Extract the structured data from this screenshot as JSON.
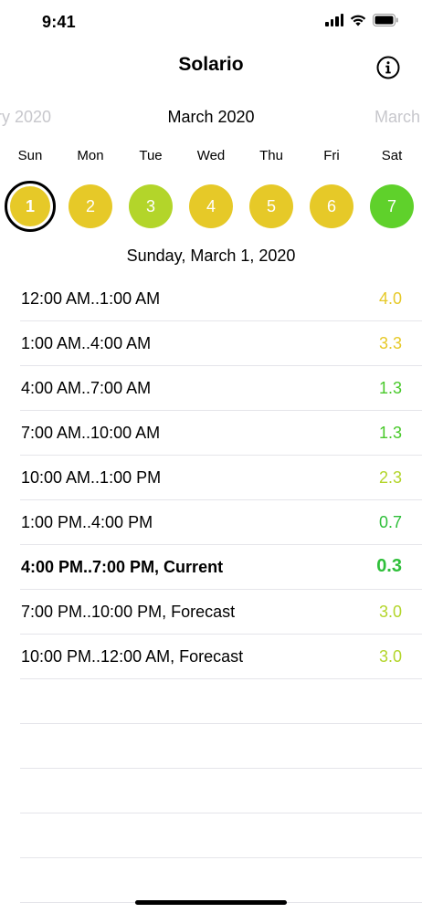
{
  "status_bar": {
    "time": "9:41"
  },
  "nav": {
    "title": "Solario"
  },
  "months": {
    "previous": "ry 2020",
    "current": "March 2020",
    "next": "March"
  },
  "weekdays": [
    "Sun",
    "Mon",
    "Tue",
    "Wed",
    "Thu",
    "Fri",
    "Sat"
  ],
  "days": [
    {
      "label": "1",
      "color": "#e6c928",
      "selected": true
    },
    {
      "label": "2",
      "color": "#e6c928",
      "selected": false
    },
    {
      "label": "3",
      "color": "#b3d52a",
      "selected": false
    },
    {
      "label": "4",
      "color": "#e6c928",
      "selected": false
    },
    {
      "label": "5",
      "color": "#e6c928",
      "selected": false
    },
    {
      "label": "6",
      "color": "#e6c928",
      "selected": false
    },
    {
      "label": "7",
      "color": "#5fd12b",
      "selected": false
    }
  ],
  "date_heading": "Sunday, March 1, 2020",
  "rows": [
    {
      "label": "12:00 AM..1:00 AM",
      "value": "4.0",
      "color": "#e6c928",
      "current": false
    },
    {
      "label": "1:00 AM..4:00 AM",
      "value": "3.3",
      "color": "#e6c928",
      "current": false
    },
    {
      "label": "4:00 AM..7:00 AM",
      "value": "1.3",
      "color": "#48c92a",
      "current": false
    },
    {
      "label": "7:00 AM..10:00 AM",
      "value": "1.3",
      "color": "#48c92a",
      "current": false
    },
    {
      "label": "10:00 AM..1:00 PM",
      "value": "2.3",
      "color": "#b3d52a",
      "current": false
    },
    {
      "label": "1:00 PM..4:00 PM",
      "value": "0.7",
      "color": "#2fbf3a",
      "current": false
    },
    {
      "label": "4:00 PM..7:00 PM, Current",
      "value": "0.3",
      "color": "#2fbf3a",
      "current": true
    },
    {
      "label": "7:00 PM..10:00 PM, Forecast",
      "value": "3.0",
      "color": "#b3d52a",
      "current": false
    },
    {
      "label": "10:00 PM..12:00 AM, Forecast",
      "value": "3.0",
      "color": "#b3d52a",
      "current": false
    }
  ],
  "empty_rows": 5,
  "icons": {
    "info": "info-circle-icon",
    "signal": "cellular-signal-icon",
    "wifi": "wifi-icon",
    "battery": "battery-icon"
  }
}
